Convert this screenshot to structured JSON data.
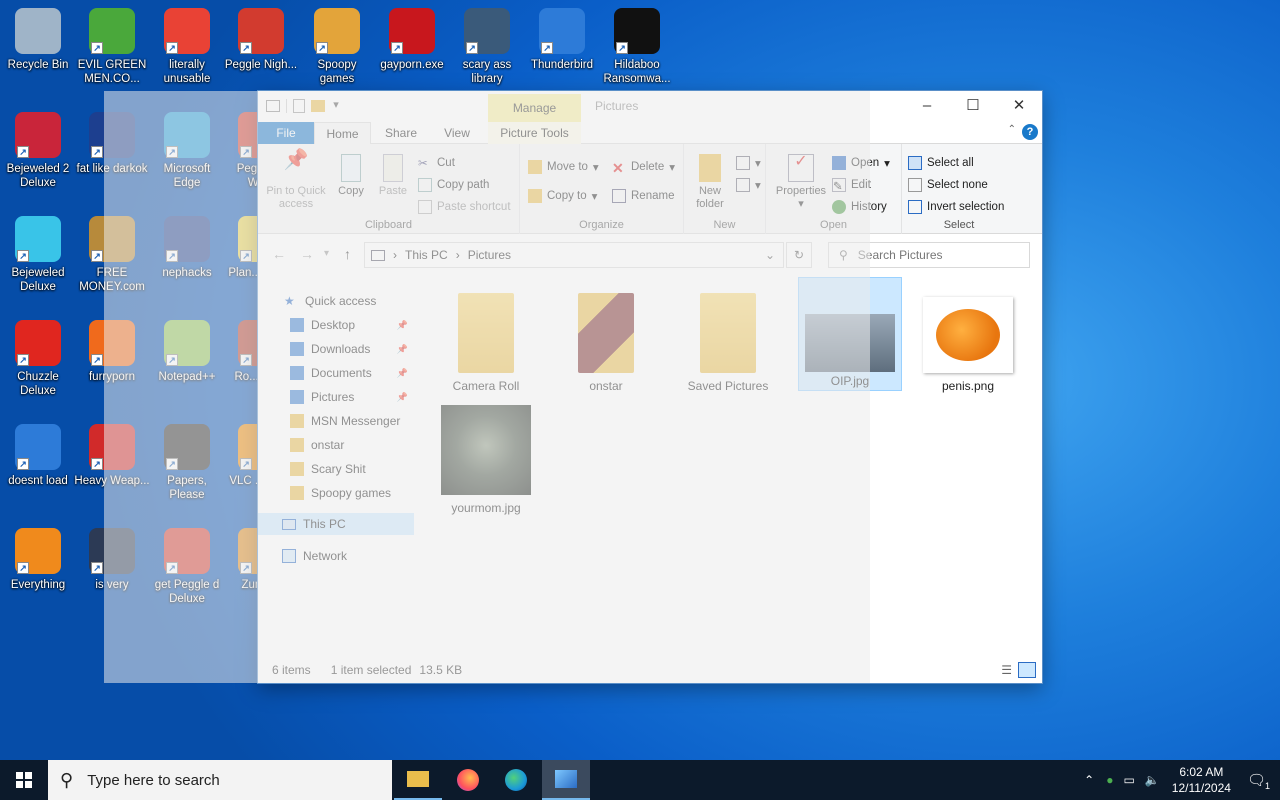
{
  "desktop_icons": [
    {
      "label": "Recycle Bin",
      "icon": "recycle-bin-icon",
      "color": "#9fb4c8"
    },
    {
      "label": "EVIL GREEN MEN.CO...",
      "icon": "msn-men-icon",
      "color": "#4aa83b"
    },
    {
      "label": "literally unusable",
      "icon": "chrome-icon",
      "color": "#e94235"
    },
    {
      "label": "Peggle Nigh...",
      "icon": "peggle-icon",
      "color": "#d23b2f"
    },
    {
      "label": "Spoopy games",
      "icon": "folder-icon",
      "color": "#e3a43a"
    },
    {
      "label": "gayporn.exe",
      "icon": "flash-icon",
      "color": "#c8171d"
    },
    {
      "label": "scary ass library",
      "icon": "library-icon",
      "color": "#3a5a7a"
    },
    {
      "label": "Thunderbird",
      "icon": "thunderbird-icon",
      "color": "#2d7bd8"
    },
    {
      "label": "Hildaboo Ransomwa...",
      "icon": "yashma-icon",
      "color": "#111111"
    },
    {
      "label": "Bejeweled 2 Deluxe",
      "icon": "bejeweled2-icon",
      "color": "#c9253a"
    },
    {
      "label": "fat like darkok",
      "icon": "mpi-icon",
      "color": "#1d3f8f"
    },
    {
      "label": "Microsoft Edge",
      "icon": "edge-icon",
      "color": "#1b9ad8"
    },
    {
      "label": "Peggle of Wa...",
      "icon": "peggle-icon",
      "color": "#d23b2f"
    },
    {
      "label": "Bejeweled Deluxe",
      "icon": "gem-icon",
      "color": "#39c4e8"
    },
    {
      "label": "FREE MONEY.com",
      "icon": "money-bag-icon",
      "color": "#b78a3b"
    },
    {
      "label": "nephacks",
      "icon": "mpi-icon",
      "color": "#1d3f8f"
    },
    {
      "label": "Plan... Zon...",
      "icon": "plants-icon",
      "color": "#e8d24a"
    },
    {
      "label": "Chuzzle Deluxe",
      "icon": "chuzzle-icon",
      "color": "#e0261f"
    },
    {
      "label": "furryporn",
      "icon": "firefox-icon",
      "color": "#f06a1c"
    },
    {
      "label": "Notepad++",
      "icon": "notepad-icon",
      "color": "#8cc152"
    },
    {
      "label": "Ro... Ma...",
      "icon": "app-icon",
      "color": "#b33a2a"
    },
    {
      "label": "doesnt load",
      "icon": "thunderbird-icon",
      "color": "#2d7bd8"
    },
    {
      "label": "Heavy Weap...",
      "icon": "radiation-icon",
      "color": "#d12a2a"
    },
    {
      "label": "Papers, Please",
      "icon": "papers-please-icon",
      "color": "#2a2a2a"
    },
    {
      "label": "VLC ... pla...",
      "icon": "vlc-icon",
      "color": "#f08a00"
    },
    {
      "label": "Everything",
      "icon": "search-magnifier-icon",
      "color": "#f08a1c"
    },
    {
      "label": "is very",
      "icon": "mpi-shield-icon",
      "color": "#2c3a55"
    },
    {
      "label": "get Peggle d Deluxe",
      "icon": "peggle-icon",
      "color": "#d23b2f"
    },
    {
      "label": "Zuma...",
      "icon": "zuma-icon",
      "color": "#e08a1a"
    }
  ],
  "explorer": {
    "manage_label": "Manage",
    "title": "Pictures",
    "tabs": {
      "file": "File",
      "home": "Home",
      "share": "Share",
      "view": "View",
      "picture_tools": "Picture Tools"
    },
    "ribbon": {
      "clipboard": {
        "label": "Clipboard",
        "pin": "Pin to Quick access",
        "copy": "Copy",
        "paste": "Paste",
        "cut": "Cut",
        "copy_path": "Copy path",
        "paste_shortcut": "Paste shortcut"
      },
      "organize": {
        "label": "Organize",
        "move_to": "Move to",
        "copy_to": "Copy to",
        "delete": "Delete",
        "rename": "Rename"
      },
      "new": {
        "label": "New",
        "new_folder": "New folder"
      },
      "open": {
        "label": "Open",
        "properties": "Properties",
        "open": "Open",
        "edit": "Edit",
        "history": "History"
      },
      "select": {
        "label": "Select",
        "select_all": "Select all",
        "select_none": "Select none",
        "invert": "Invert selection"
      }
    },
    "address": {
      "this_pc": "This PC",
      "pictures": "Pictures"
    },
    "search_placeholder": "Search Pictures",
    "nav": {
      "quick_access": "Quick access",
      "items": [
        {
          "label": "Desktop",
          "pinned": true,
          "icon": "desktop-icon"
        },
        {
          "label": "Downloads",
          "pinned": true,
          "icon": "download-icon"
        },
        {
          "label": "Documents",
          "pinned": true,
          "icon": "documents-icon"
        },
        {
          "label": "Pictures",
          "pinned": true,
          "icon": "pictures-icon"
        },
        {
          "label": "MSN Messenger",
          "pinned": false,
          "icon": "folder-icon"
        },
        {
          "label": "onstar",
          "pinned": false,
          "icon": "folder-icon"
        },
        {
          "label": "Scary Shit",
          "pinned": false,
          "icon": "folder-icon"
        },
        {
          "label": "Spoopy games",
          "pinned": false,
          "icon": "folder-icon"
        }
      ],
      "this_pc": "This PC",
      "network": "Network"
    },
    "files": [
      {
        "name": "Camera Roll",
        "type": "folder"
      },
      {
        "name": "onstar",
        "type": "folder-thumb"
      },
      {
        "name": "Saved Pictures",
        "type": "folder"
      },
      {
        "name": "OIP.jpg",
        "type": "image",
        "selected": true
      },
      {
        "name": "penis.png",
        "type": "image-pumpkin"
      },
      {
        "name": "yourmom.jpg",
        "type": "image-face"
      }
    ],
    "status": {
      "count": "6 items",
      "selected": "1 item selected",
      "size": "13.5 KB"
    }
  },
  "taskbar": {
    "search_placeholder": "Type here to search",
    "apps": [
      "file-explorer-icon",
      "firefox-icon",
      "edge-icon",
      "photos-icon"
    ],
    "time": "6:02 AM",
    "date": "12/11/2024",
    "notification_count": "1"
  }
}
